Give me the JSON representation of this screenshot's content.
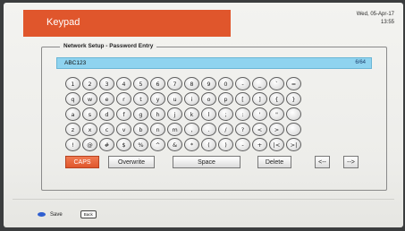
{
  "header": {
    "title": "Keypad",
    "date": "Wed, 05-Apr-17",
    "time": "13:55"
  },
  "panel": {
    "legend": "Network Setup - Password Entry",
    "password_value": "ABC123",
    "password_count": "6/64"
  },
  "keyboard": {
    "rows": [
      [
        "1",
        "2",
        "3",
        "4",
        "5",
        "6",
        "7",
        "8",
        "9",
        "0",
        "-",
        "_",
        "`",
        "="
      ],
      [
        "q",
        "w",
        "e",
        "r",
        "t",
        "y",
        "u",
        "i",
        "o",
        "p",
        "[",
        "]",
        "{",
        "}"
      ],
      [
        "a",
        "s",
        "d",
        "f",
        "g",
        "h",
        "j",
        "k",
        "l",
        ";",
        ":",
        "'",
        "\"",
        ""
      ],
      [
        "z",
        "x",
        "c",
        "v",
        "b",
        "n",
        "m",
        ",",
        ".",
        "/",
        "?",
        "<",
        ">",
        ""
      ],
      [
        "!",
        "@",
        "#",
        "$",
        "%",
        "^",
        "&",
        "*",
        "(",
        ")",
        "-",
        "+",
        "|<",
        ">|"
      ]
    ]
  },
  "buttons": {
    "caps": "CAPS",
    "overwrite": "Overwrite",
    "space": "Space",
    "delete": "Delete",
    "left": "<--",
    "right": "-->"
  },
  "footer": {
    "save": "Save",
    "back": "Back"
  },
  "colors": {
    "accent": "#e0562c",
    "field": "#8fd3ef",
    "save_dot": "#2f5fd0"
  }
}
